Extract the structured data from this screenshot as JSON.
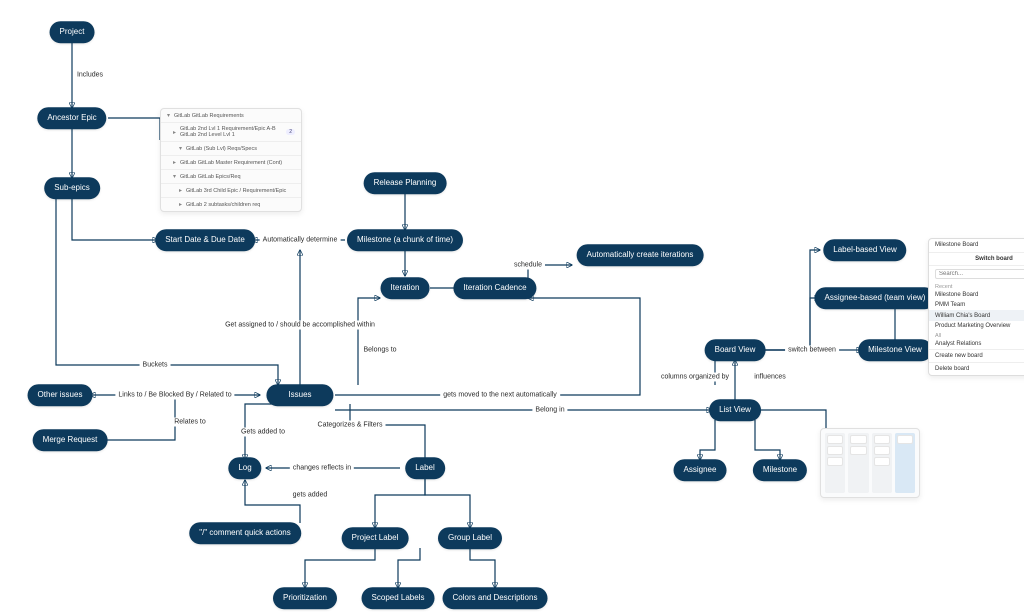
{
  "nodes": {
    "project": "Project",
    "ancestor_epic": "Ancestor Epic",
    "sub_epics": "Sub-epics",
    "start_due": "Start Date & Due Date",
    "milestone_chunk": "Milestone (a chunk of time)",
    "release_planning": "Release Planning",
    "iteration": "Iteration",
    "iteration_cadence": "Iteration Cadence",
    "auto_iterations": "Automatically create iterations",
    "other_issues": "Other issues",
    "merge_request": "Merge Request",
    "issues": "Issues",
    "log": "Log",
    "quick_actions": "\"/\" comment quick actions",
    "label": "Label",
    "project_label": "Project Label",
    "group_label": "Group Label",
    "prioritization": "Prioritization",
    "scoped_labels": "Scoped Labels",
    "colors_desc": "Colors and Descriptions",
    "board_view": "Board View",
    "list_view": "List View",
    "assignee": "Assignee",
    "milestone_node": "Milestone",
    "label_view": "Label-based View",
    "assignee_view": "Assignee-based (team view)",
    "milestone_view": "Milestone View"
  },
  "edge_labels": {
    "includes": "Includes",
    "auto_determine": "Automatically determine",
    "get_assigned": "Get assigned to / should be accomplished within",
    "belongs_to": "Belongs to",
    "buckets": "Buckets",
    "links_to": "Links to / Be Blocked By / Related to",
    "relates_to": "Relates to",
    "gets_added_to": "Gets added to",
    "categorizes": "Categorizes & Filters",
    "changes_reflects": "changes reflects in",
    "gets_added": "gets added",
    "schedule": "schedule",
    "gets_moved": "gets moved to the next automatically",
    "belong_in": "Belong in",
    "columns_org": "columns organized by",
    "switch_between": "switch between",
    "influences": "influences"
  },
  "epic_panel": {
    "rows": [
      "GitLab GitLab Requirements",
      "GitLab 2nd Lvl 1 Requirement/Epic A-B GitLab 2nd Level Lvl 1",
      "GitLab (Sub Lvl) Reqs/Specs",
      "GitLab GitLab Master Requirement (Cont)",
      "GitLab GitLab Epics/Req",
      "GitLab 3rd Child Epic / Requirement/Epic",
      "GitLab 2 subtasks/children req"
    ]
  },
  "board_dropdown": {
    "selected": "Milestone Board",
    "title": "Switch board",
    "section_recent": "Recent",
    "recent": [
      "Milestone Board",
      "PMM Team",
      "William Chia's Board",
      "Product Marketing Overview"
    ],
    "all_section": "All",
    "all": [
      "Analyst Relations"
    ],
    "footer1": "Create new board",
    "footer2": "Delete board",
    "search_ph": "Search..."
  }
}
